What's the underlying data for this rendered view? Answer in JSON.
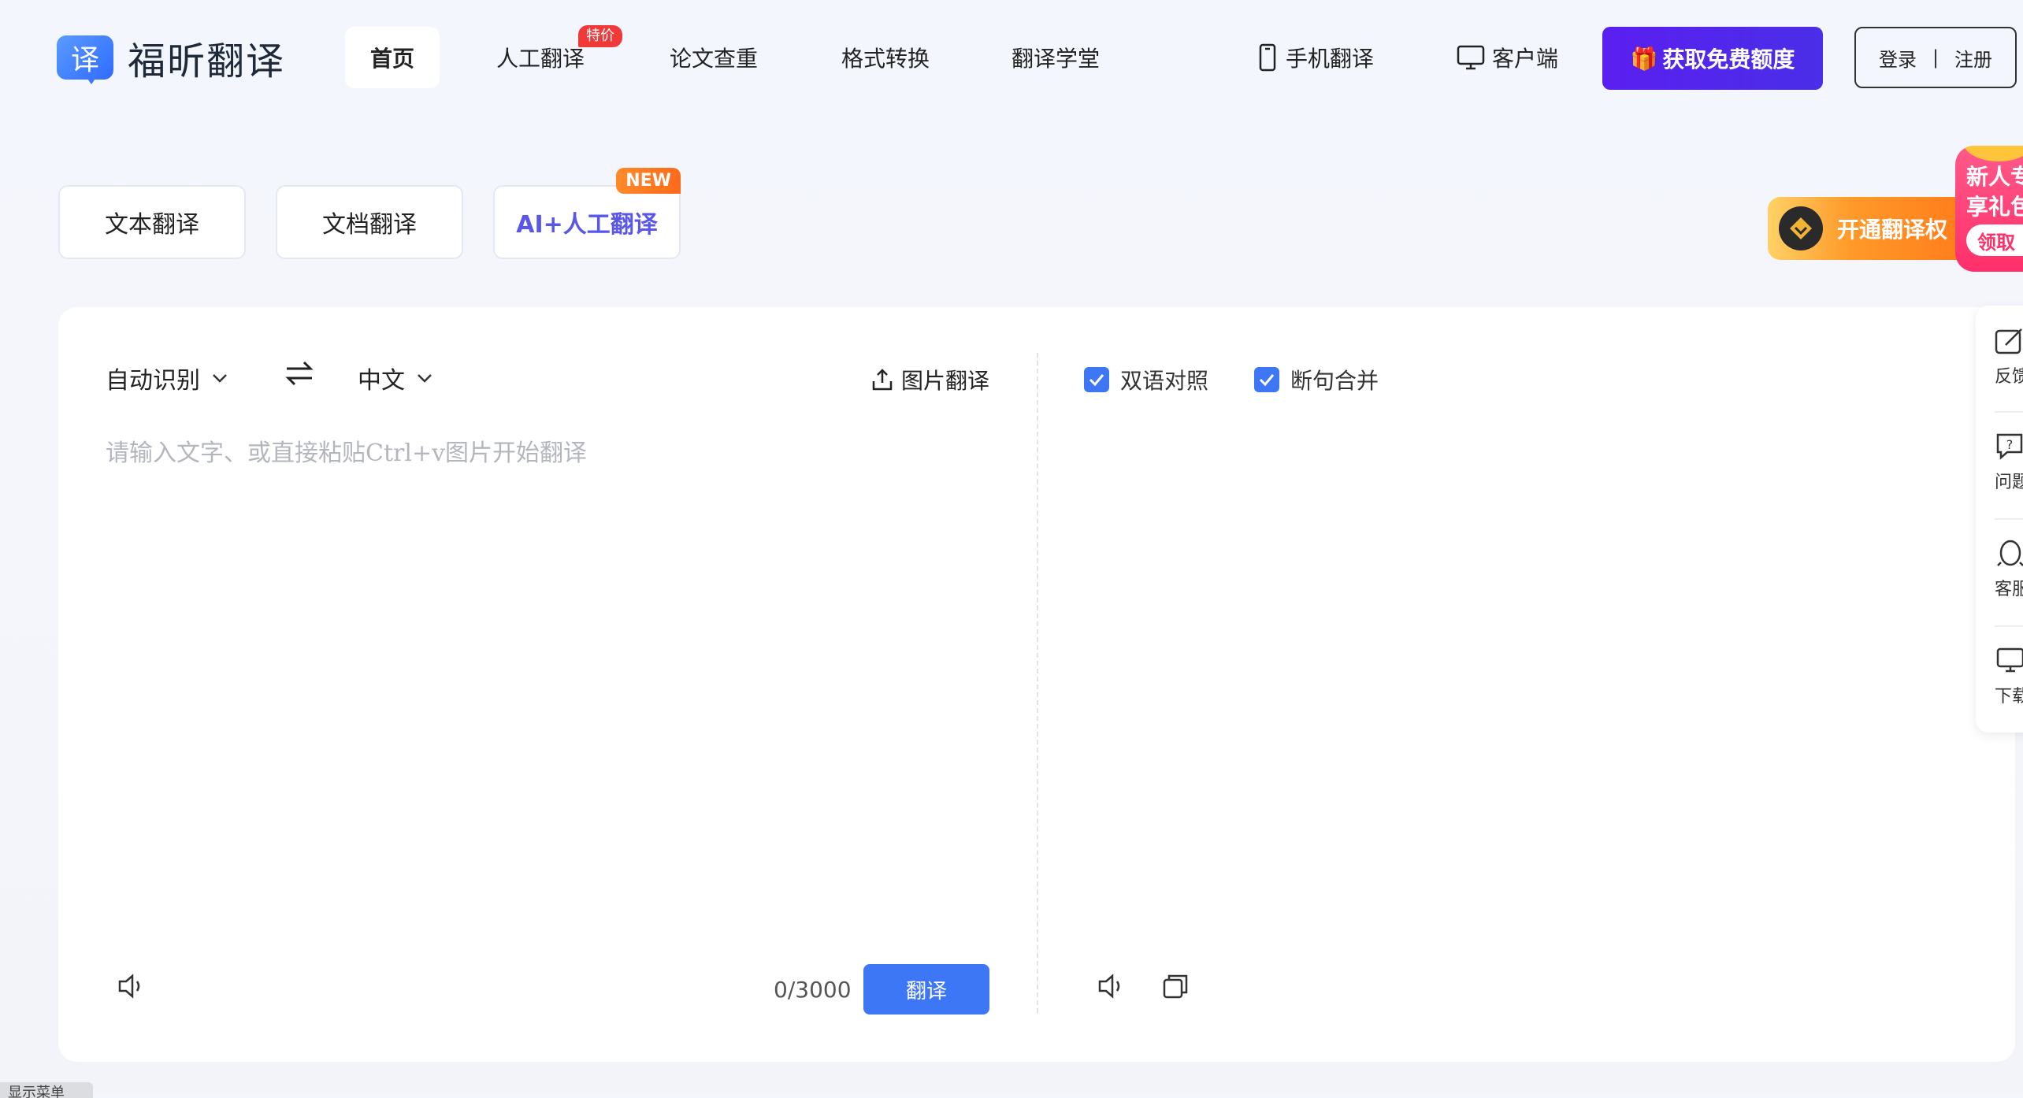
{
  "brand": {
    "logo_char": "译",
    "name": "福昕翻译"
  },
  "nav": {
    "items": [
      "首页",
      "人工翻译",
      "论文查重",
      "格式转换",
      "翻译学堂"
    ],
    "hot_badge": "特价"
  },
  "tools": {
    "mobile": "手机翻译",
    "client": "客户端"
  },
  "header": {
    "free_quota": "获取免费额度",
    "login": "登录",
    "separator": "|",
    "register": "注册"
  },
  "mode_tabs": [
    "文本翻译",
    "文档翻译",
    "AI+人工翻译"
  ],
  "new_badge": "NEW",
  "promo": {
    "vip": "开通翻译权",
    "gift_line1": "新人专",
    "gift_line2": "享礼包",
    "gift_btn": "领取"
  },
  "translator": {
    "source_lang": "自动识别",
    "target_lang": "中文",
    "image_translate": "图片翻译",
    "placeholder": "请输入文字、或直接粘贴Ctrl+v图片开始翻译",
    "counter": "0/3000",
    "translate_btn": "翻译",
    "option_bilingual": "双语对照",
    "option_merge": "断句合并"
  },
  "side": {
    "feedback": "反馈",
    "faq": "问题",
    "service": "客服",
    "download": "下载"
  },
  "bottom_tab": "显示菜单",
  "colors": {
    "primary": "#3e77f5",
    "purple": "#5a1ff0",
    "hot": "#f03a3a",
    "new": "#ff7a1a"
  }
}
